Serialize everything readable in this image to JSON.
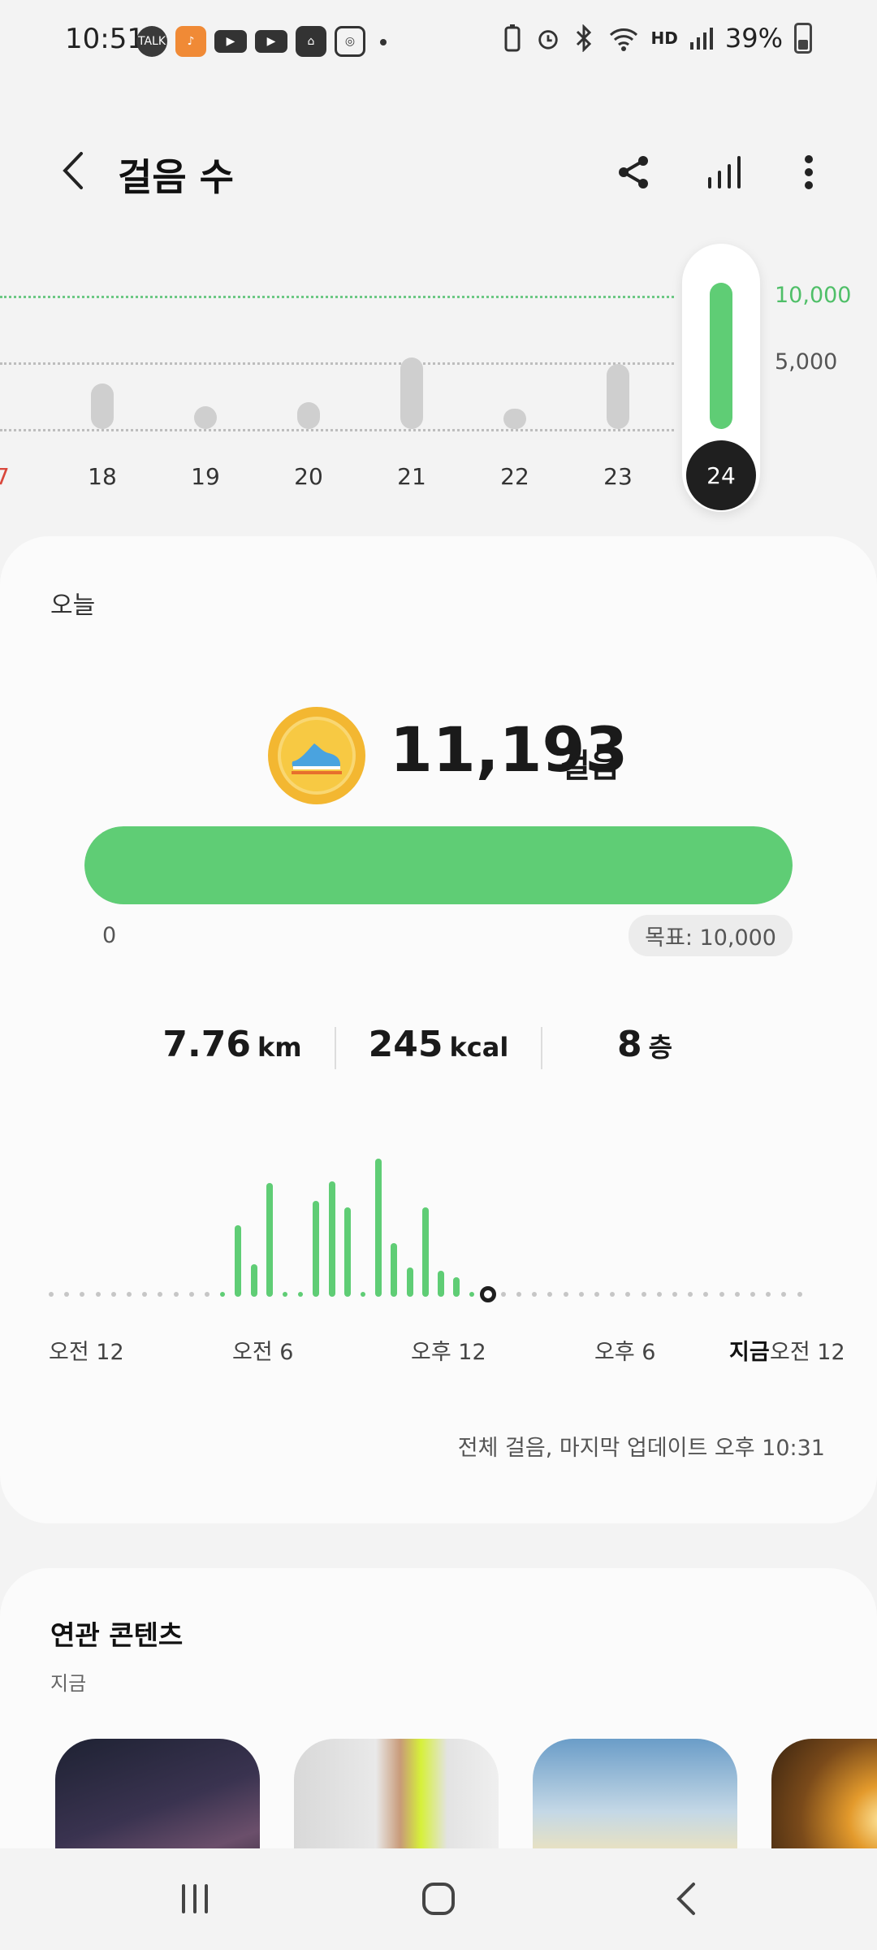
{
  "status_bar": {
    "time": "10:51",
    "battery": "39%",
    "hd_voice": "HD"
  },
  "header": {
    "title": "걸음 수"
  },
  "weekly_chart": {
    "days": [
      "17",
      "18",
      "19",
      "20",
      "21",
      "22",
      "23",
      "24"
    ],
    "selected_day": "24",
    "goal_label": "10,000",
    "mid_label": "5,000"
  },
  "today": {
    "label": "오늘",
    "steps": "11,193",
    "steps_unit": "걸음",
    "progress_min": "0",
    "goal": "목표: 10,000",
    "progress_fraction": 1.0,
    "distance": "7.76",
    "distance_unit": "km",
    "calories": "245",
    "calories_unit": "kcal",
    "floors": "8",
    "floors_unit": "층",
    "time_labels": [
      "오전 12",
      "오전 6",
      "오후 12",
      "오후 6",
      "지금",
      "오전 12"
    ],
    "update_note": "전체 걸음, 마지막 업데이트 오후 10:31"
  },
  "related": {
    "title": "연관 콘텐츠",
    "subtitle": "지금"
  },
  "colors": {
    "accent_green": "#5fcd75",
    "weekend_red": "#d9473b",
    "medal": "#f3b731"
  },
  "icons": [
    "back-icon",
    "share-icon",
    "bar-chart-icon",
    "more-vert-icon",
    "recents-icon",
    "home-icon",
    "nav-back-icon"
  ]
}
